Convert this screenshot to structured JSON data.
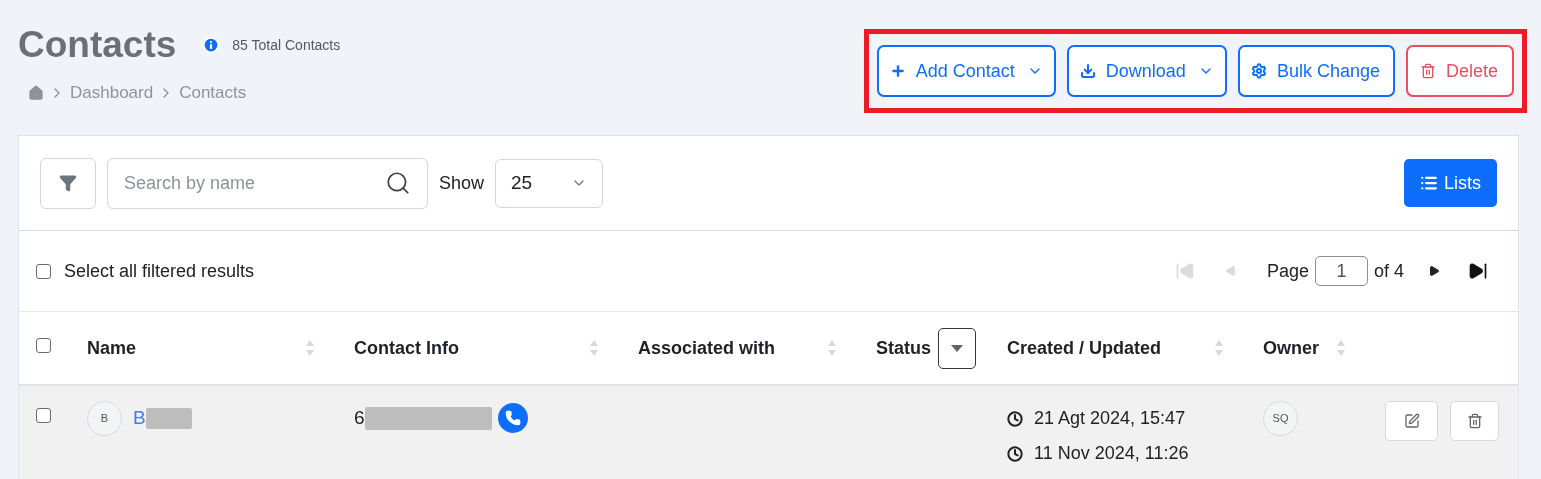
{
  "header": {
    "title": "Contacts",
    "total": "85 Total Contacts",
    "breadcrumb": [
      "Dashboard",
      "Contacts"
    ]
  },
  "actions": [
    {
      "label": "Add Contact",
      "kind": "add",
      "caret": true
    },
    {
      "label": "Download",
      "kind": "download",
      "caret": true
    },
    {
      "label": "Bulk Change",
      "kind": "bulk",
      "caret": false
    },
    {
      "label": "Delete",
      "kind": "delete",
      "caret": false
    }
  ],
  "highlight": {
    "color": "#ed1c24"
  },
  "toolbar": {
    "search": {
      "placeholder": "Search by name"
    },
    "show_label": "Show",
    "page_size": "25",
    "lists_button": "Lists"
  },
  "selection": {
    "label": "Select all filtered results",
    "checked": false
  },
  "pagination": {
    "page_label": "Page",
    "page": "1",
    "of": "of 4",
    "first_disabled": true,
    "prev_disabled": true
  },
  "table": {
    "header_checked": false,
    "columns": [
      {
        "label": "Name",
        "kind": "sort"
      },
      {
        "label": "Contact Info",
        "kind": "sort"
      },
      {
        "label": "Associated with",
        "kind": "sort"
      },
      {
        "label": "Status",
        "kind": "filter"
      },
      {
        "label": "Created / Updated",
        "kind": "sort"
      },
      {
        "label": "Owner",
        "kind": "sort"
      }
    ],
    "rows": [
      {
        "checked": false,
        "avatar": "B",
        "name": "B",
        "phone": "6",
        "created": "21 Agt 2024, 15:47",
        "updated": "11 Nov 2024, 11:26",
        "owner": "SQ"
      }
    ]
  }
}
